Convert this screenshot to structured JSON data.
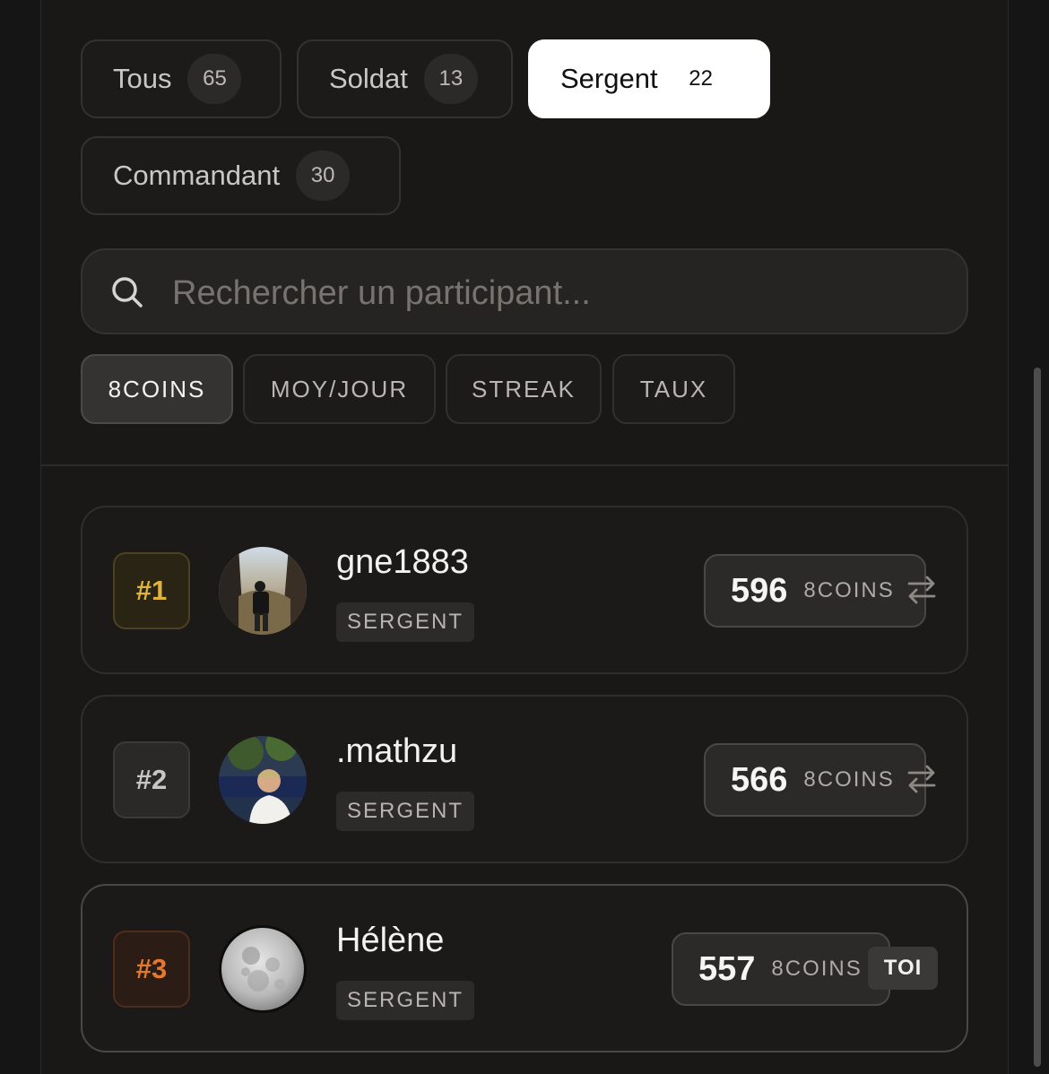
{
  "categories": [
    {
      "label": "Tous",
      "count": "65"
    },
    {
      "label": "Soldat",
      "count": "13"
    },
    {
      "label": "Sergent",
      "count": "22"
    },
    {
      "label": "Commandant",
      "count": "30"
    }
  ],
  "active_category": "Sergent",
  "search": {
    "placeholder": "Rechercher un participant...",
    "value": ""
  },
  "sort_tabs": [
    "8COINS",
    "MOY/JOUR",
    "STREAK",
    "TAUX"
  ],
  "active_sort": "8COINS",
  "ranking": [
    {
      "rank": "#1",
      "username": "gne1883",
      "grade": "SERGENT",
      "score": "596",
      "unit": "8COINS",
      "action_icon": "swap-arrows-icon"
    },
    {
      "rank": "#2",
      "username": ".mathzu",
      "grade": "SERGENT",
      "score": "566",
      "unit": "8COINS",
      "action_icon": "swap-arrows-icon"
    },
    {
      "rank": "#3",
      "username": "Hélène",
      "grade": "SERGENT",
      "score": "557",
      "unit": "8COINS",
      "badge": "TOI"
    }
  ],
  "colors": {
    "background": "#151515",
    "gold_rank": "#e0b33e",
    "bronze_rank": "#e5782f",
    "active_chip": "#ffffff"
  }
}
